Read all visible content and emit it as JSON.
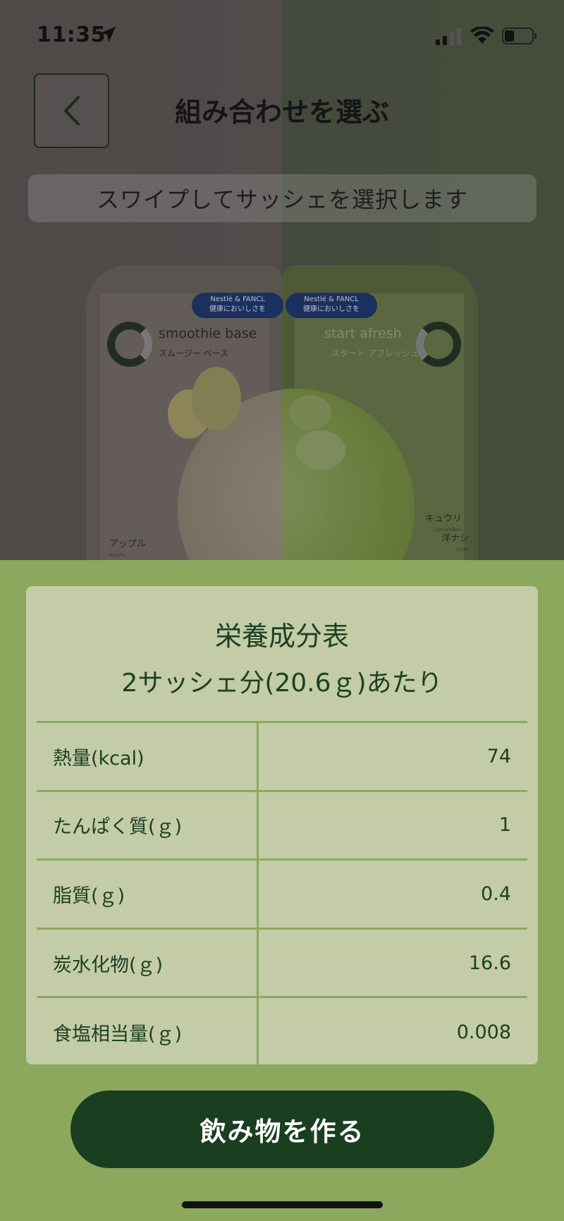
{
  "status_bar": {
    "time": "11:35",
    "icons": [
      "location-arrow-icon",
      "signal-icon",
      "wifi-icon",
      "battery-icon"
    ]
  },
  "header": {
    "back_icon": "chevron-left-icon",
    "title": "組み合わせを選ぶ"
  },
  "hint": "スワイプしてサッシェを選択します",
  "sachets": {
    "left": {
      "brand_line1": "Nestlé & FANCL",
      "brand_line2": "健康においしさを",
      "name_en": "smoothie base",
      "name_ja": "スムージー ベース",
      "flavor_ja": "アップル",
      "flavor_en": "apple"
    },
    "right": {
      "brand_line1": "Nestlé & FANCL",
      "brand_line2": "健康においしさを",
      "name_en": "start afresh",
      "name_ja": "スタート アフレッシュ",
      "flavor1_ja": "キュウリ",
      "flavor1_en": "cucumber",
      "flavor2_ja": "洋ナシ",
      "flavor2_en": "pear"
    }
  },
  "nutrition": {
    "title": "栄養成分表",
    "subtitle": "2サッシェ分(20.6ｇ)あたり",
    "rows": [
      {
        "label": "熱量(kcal)",
        "value": "74"
      },
      {
        "label": "たんぱく質(ｇ)",
        "value": "1"
      },
      {
        "label": "脂質(ｇ)",
        "value": "0.4"
      },
      {
        "label": "炭水化物(ｇ)",
        "value": "16.6"
      },
      {
        "label": "食塩相当量(ｇ)",
        "value": "0.008"
      }
    ]
  },
  "cta": {
    "label": "飲み物を作る"
  },
  "colors": {
    "background_green": "#8ba85c",
    "card_bg": "#c3cca6",
    "text_dark_green": "#1c4023",
    "button_dark_green": "#1a3e20"
  }
}
